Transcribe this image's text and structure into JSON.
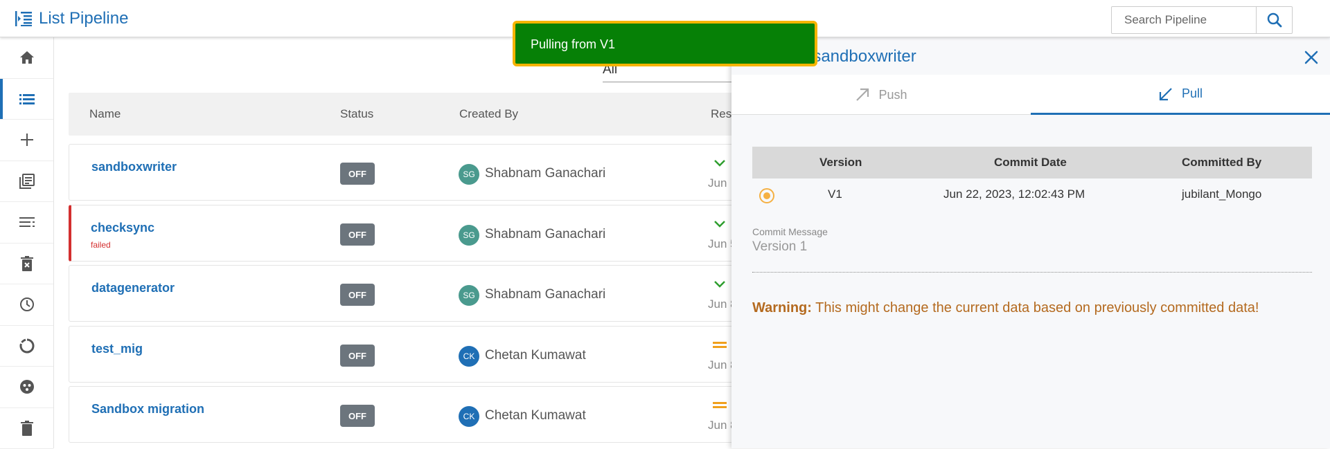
{
  "header": {
    "title": "List Pipeline",
    "search_placeholder": "Search Pipeline"
  },
  "sidebar": {
    "items": [
      "home-icon",
      "list-icon",
      "plus-icon",
      "library-icon",
      "lines-icon",
      "trash-x-icon",
      "clock-icon",
      "donut-icon",
      "group-icon",
      "trash-icon"
    ]
  },
  "filter": {
    "value": "All"
  },
  "table": {
    "headers": {
      "name": "Name",
      "status": "Status",
      "created_by": "Created By",
      "result": "Res"
    },
    "rows": [
      {
        "name": "sandboxwriter",
        "sub": "",
        "status": "OFF",
        "initials": "SG",
        "creator": "Shabnam Ganachari",
        "date": "Jun",
        "avatar_color": "#4a9a8e",
        "res_icon": "check"
      },
      {
        "name": "checksync",
        "sub": "failed",
        "status": "OFF",
        "initials": "SG",
        "creator": "Shabnam Ganachari",
        "date": "Jun 5",
        "avatar_color": "#4a9a8e",
        "res_icon": "check"
      },
      {
        "name": "datagenerator",
        "sub": "",
        "status": "OFF",
        "initials": "SG",
        "creator": "Shabnam Ganachari",
        "date": "Jun 8",
        "avatar_color": "#4a9a8e",
        "res_icon": "check"
      },
      {
        "name": "test_mig",
        "sub": "",
        "status": "OFF",
        "initials": "CK",
        "creator": "Chetan Kumawat",
        "date": "Jun 8",
        "avatar_color": "#1f6fb5",
        "res_icon": "equals"
      },
      {
        "name": "Sandbox migration",
        "sub": "",
        "status": "OFF",
        "initials": "CK",
        "creator": "Chetan Kumawat",
        "date": "Jun 8",
        "avatar_color": "#1f6fb5",
        "res_icon": "equals"
      }
    ]
  },
  "panel": {
    "title": "ll sandboxwriter",
    "tabs": {
      "push": "Push",
      "pull": "Pull"
    },
    "versions": {
      "headers": {
        "version": "Version",
        "commit_date": "Commit Date",
        "committed_by": "Committed By"
      },
      "rows": [
        {
          "version": "V1",
          "commit_date": "Jun 22, 2023, 12:02:43 PM",
          "committed_by": "jubilant_Mongo"
        }
      ]
    },
    "commit_message": {
      "label": "Commit Message",
      "value": "Version 1"
    },
    "warning": {
      "label": "Warning:",
      "text": " This might change the current data based on previously committed data!"
    }
  },
  "toast": {
    "text": "Pulling from V1"
  },
  "colors": {
    "accent": "#1f6fb5",
    "toast_bg": "#068006",
    "toast_border": "#f5b400",
    "warning": "#b46a1f",
    "failed": "#d32f2f",
    "off_badge": "#6c757d"
  }
}
